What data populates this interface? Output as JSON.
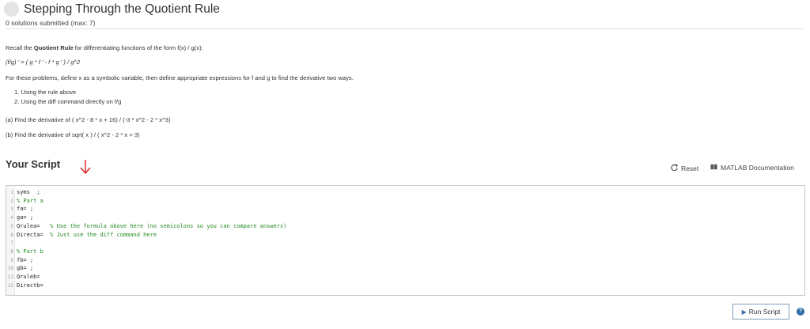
{
  "problem": {
    "title": "Stepping Through the Quotient Rule",
    "submissions": "0 solutions submitted (max: 7)"
  },
  "description": {
    "recall_prefix": "Recall the ",
    "recall_bold": "Quotient Rule",
    "recall_suffix": " for differentiating functions of the form f(x) / g(x):",
    "formula": "(f/g) ' = ( g * f ' - f * g ' ) / g^2",
    "instructions": "For these problems, define x as a symbolic variable, then define appropriate expressions for f and g to find the derivative two ways.",
    "steps": [
      "1. Using the rule above",
      "2. Using the diff command directly on f/g"
    ],
    "part_a": "(a) Find the derivative of ( x^2 - 8 * x + 16) / (-3 * x^2 - 2 * x^3)",
    "part_b": "(b) Find the derivative of sqrt( x ) / ( x^2 - 2 * x + 3)"
  },
  "script": {
    "heading": "Your Script",
    "reset_label": "Reset",
    "docs_label": "MATLAB Documentation",
    "lines": [
      {
        "num": "1",
        "code": "syms  ;",
        "comment": ""
      },
      {
        "num": "2",
        "code": "",
        "comment": "% Part a"
      },
      {
        "num": "3",
        "code": "fa= ;",
        "comment": ""
      },
      {
        "num": "4",
        "code": "ga= ;",
        "comment": ""
      },
      {
        "num": "5",
        "code": "Qrulea=   ",
        "comment": "% Use the formula above here (no semicolons so you can compare answers)"
      },
      {
        "num": "6",
        "code": "Directa=  ",
        "comment": "% Just use the diff command here"
      },
      {
        "num": "7",
        "code": "",
        "comment": ""
      },
      {
        "num": "8",
        "code": "",
        "comment": "% Part b"
      },
      {
        "num": "9",
        "code": "fb= ;",
        "comment": ""
      },
      {
        "num": "10",
        "code": "gb= ;",
        "comment": ""
      },
      {
        "num": "11",
        "code": "Qruleb=",
        "comment": ""
      },
      {
        "num": "12",
        "code": "Directb=",
        "comment": ""
      }
    ]
  },
  "actions": {
    "run_label": "Run Script",
    "help_glyph": "?"
  },
  "colors": {
    "accent": "#2e6da4",
    "comment": "#228b22",
    "annotation_arrow": "#e02020"
  },
  "icons": {
    "status": "circle-status-icon",
    "reset": "refresh-icon",
    "docs": "book-icon",
    "run": "play-icon",
    "help": "question-icon",
    "annotation": "red-arrow-icon"
  }
}
